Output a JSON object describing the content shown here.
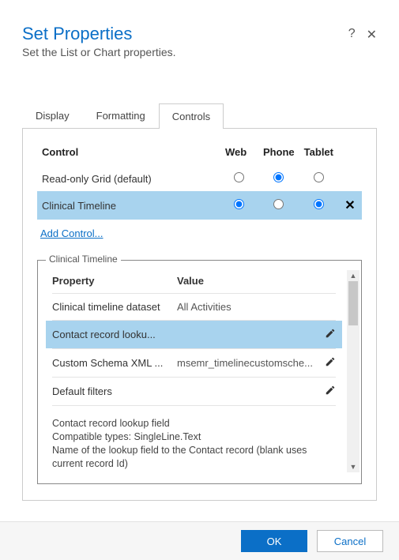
{
  "header": {
    "title": "Set Properties",
    "subtitle": "Set the List or Chart properties."
  },
  "tabs": {
    "display": "Display",
    "formatting": "Formatting",
    "controls": "Controls"
  },
  "controlTable": {
    "headers": {
      "control": "Control",
      "web": "Web",
      "phone": "Phone",
      "tablet": "Tablet"
    },
    "rows": [
      {
        "name": "Read-only Grid (default)"
      },
      {
        "name": "Clinical Timeline"
      }
    ],
    "addControl": "Add Control..."
  },
  "fieldset": {
    "legend": "Clinical Timeline",
    "headers": {
      "property": "Property",
      "value": "Value"
    },
    "rows": [
      {
        "property": "Clinical timeline dataset",
        "value": "All Activities"
      },
      {
        "property": "Contact record looku...",
        "value": ""
      },
      {
        "property": "Custom Schema XML ...",
        "value": "msemr_timelinecustomsche..."
      },
      {
        "property": "Default filters",
        "value": ""
      }
    ],
    "description": {
      "line1": "Contact record lookup field",
      "line2": "Compatible types: SingleLine.Text",
      "line3": "Name of the lookup field to the Contact record (blank uses current record Id)"
    }
  },
  "footer": {
    "ok": "OK",
    "cancel": "Cancel"
  }
}
